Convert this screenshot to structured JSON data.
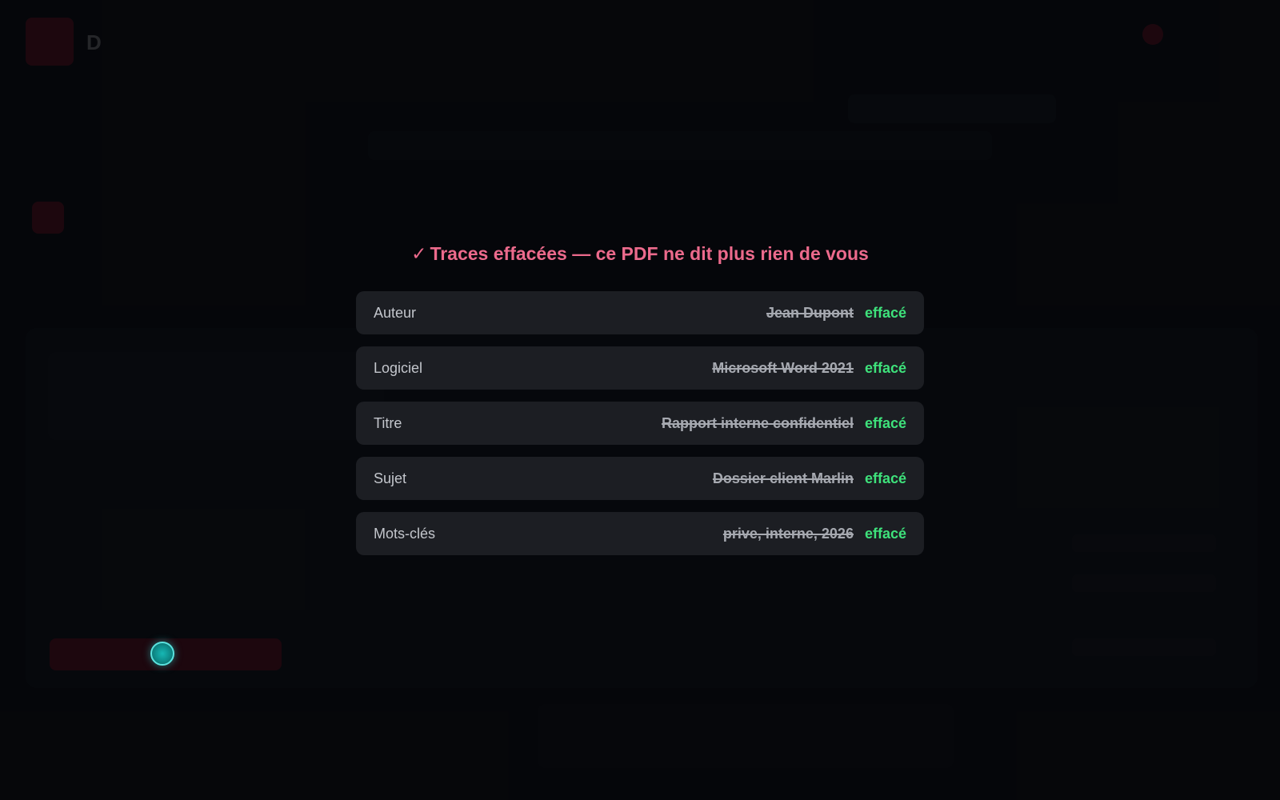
{
  "background": {
    "logo_text": "D",
    "top_links": [],
    "user_name": "",
    "nav_items": [],
    "page_heading": "",
    "file_name": "",
    "hint": "",
    "footer_title": ""
  },
  "overlay": {
    "check_symbol": "✓",
    "title": "Traces effacées — ce PDF ne dit plus rien de vous",
    "rows": [
      {
        "label": "Auteur",
        "value": "Jean Dupont",
        "status": "effacé"
      },
      {
        "label": "Logiciel",
        "value": "Microsoft Word 2021",
        "status": "effacé"
      },
      {
        "label": "Titre",
        "value": "Rapport interne confidentiel",
        "status": "effacé"
      },
      {
        "label": "Sujet",
        "value": "Dossier client Marlin",
        "status": "effacé"
      },
      {
        "label": "Mots-clés",
        "value": "prive, interne, 2026",
        "status": "effacé"
      }
    ]
  },
  "colors": {
    "accent_pink": "#ec6a8c",
    "success_green": "#3ee27b",
    "brand_red": "#b2112a",
    "cursor_teal": "#17b7b4"
  },
  "icons": {
    "check": "check-icon",
    "cursor": "cursor-indicator"
  }
}
